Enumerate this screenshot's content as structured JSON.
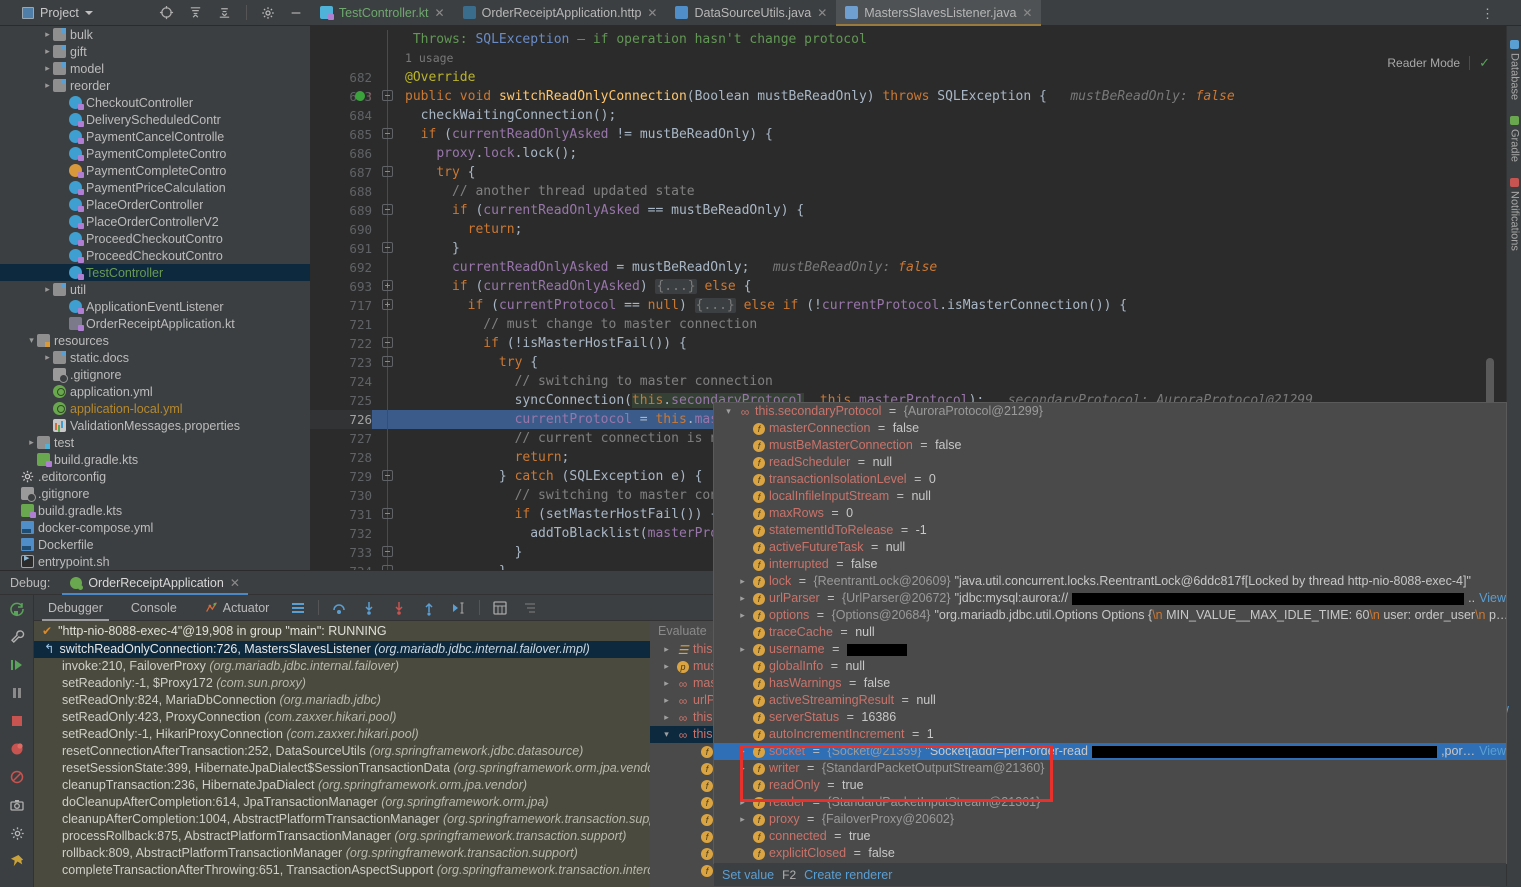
{
  "topbar": {
    "project_label": "Project",
    "icons": [
      "locate-icon",
      "expand-all-icon",
      "collapse-all-icon",
      "settings-gear-icon",
      "hide-icon"
    ],
    "overflow_menu": "⋮"
  },
  "editor_tabs": [
    {
      "label": "TestController.kt",
      "icon": "kotlin-class-icon",
      "active": false,
      "kind": "kt"
    },
    {
      "label": "OrderReceiptApplication.http",
      "icon": "http-request-icon",
      "active": false,
      "kind": "http"
    },
    {
      "label": "DataSourceUtils.java",
      "icon": "java-class-icon",
      "active": false,
      "kind": "java"
    },
    {
      "label": "MastersSlavesListener.java",
      "icon": "java-class-icon",
      "active": true,
      "kind": "javag"
    }
  ],
  "project_tree": [
    {
      "indent": 2,
      "arrow": "▸",
      "icon": "folder-icon",
      "label": "bulk",
      "color": ""
    },
    {
      "indent": 2,
      "arrow": "▸",
      "icon": "folder-icon",
      "label": "gift",
      "color": ""
    },
    {
      "indent": 2,
      "arrow": "▸",
      "icon": "folder-icon",
      "label": "model",
      "color": ""
    },
    {
      "indent": 2,
      "arrow": "▸",
      "icon": "folder-icon",
      "label": "reorder",
      "color": ""
    },
    {
      "indent": 3,
      "arrow": "",
      "icon": "kotlin-class-icon",
      "label": "CheckoutController",
      "color": ""
    },
    {
      "indent": 3,
      "arrow": "",
      "icon": "kotlin-class-icon",
      "label": "DeliveryScheduledContr",
      "color": ""
    },
    {
      "indent": 3,
      "arrow": "",
      "icon": "kotlin-class-icon",
      "label": "PaymentCancelControlle",
      "color": ""
    },
    {
      "indent": 3,
      "arrow": "",
      "icon": "kotlin-class-icon",
      "label": "PaymentCompleteContro",
      "color": ""
    },
    {
      "indent": 3,
      "arrow": "",
      "icon": "kotlin-class-icon-orange",
      "label": "PaymentCompleteContro",
      "color": ""
    },
    {
      "indent": 3,
      "arrow": "",
      "icon": "kotlin-class-icon",
      "label": "PaymentPriceCalculation",
      "color": ""
    },
    {
      "indent": 3,
      "arrow": "",
      "icon": "kotlin-class-icon",
      "label": "PlaceOrderController",
      "color": ""
    },
    {
      "indent": 3,
      "arrow": "",
      "icon": "kotlin-class-icon",
      "label": "PlaceOrderControllerV2",
      "color": ""
    },
    {
      "indent": 3,
      "arrow": "",
      "icon": "kotlin-class-icon",
      "label": "ProceedCheckoutContro",
      "color": ""
    },
    {
      "indent": 3,
      "arrow": "",
      "icon": "kotlin-class-icon",
      "label": "ProceedCheckoutContro",
      "color": ""
    },
    {
      "indent": 3,
      "arrow": "",
      "icon": "kotlin-class-icon",
      "label": "TestController",
      "color": "green",
      "selected": true
    },
    {
      "indent": 2,
      "arrow": "▸",
      "icon": "folder-icon",
      "label": "util",
      "color": ""
    },
    {
      "indent": 3,
      "arrow": "",
      "icon": "kotlin-class-icon",
      "label": "ApplicationEventListener",
      "color": ""
    },
    {
      "indent": 3,
      "arrow": "",
      "icon": "kotlin-file-icon",
      "label": "OrderReceiptApplication.kt",
      "color": ""
    },
    {
      "indent": 1,
      "arrow": "▾",
      "icon": "resources-folder-icon",
      "label": "resources",
      "color": ""
    },
    {
      "indent": 2,
      "arrow": "▸",
      "icon": "folder-plain-icon",
      "label": "static.docs",
      "color": ""
    },
    {
      "indent": 2,
      "arrow": "",
      "icon": "gitignore-icon",
      "label": ".gitignore",
      "color": ""
    },
    {
      "indent": 2,
      "arrow": "",
      "icon": "yaml-icon",
      "label": "application.yml",
      "color": ""
    },
    {
      "indent": 2,
      "arrow": "",
      "icon": "yaml-icon",
      "label": "application-local.yml",
      "color": "yellow"
    },
    {
      "indent": 2,
      "arrow": "",
      "icon": "properties-icon",
      "label": "ValidationMessages.properties",
      "color": ""
    },
    {
      "indent": 1,
      "arrow": "▸",
      "icon": "test-folder-icon",
      "label": "test",
      "color": ""
    },
    {
      "indent": 1,
      "arrow": "",
      "icon": "gradle-icon",
      "label": "build.gradle.kts",
      "color": ""
    },
    {
      "indent": 0,
      "arrow": "",
      "icon": "editorconfig-icon",
      "label": ".editorconfig",
      "color": ""
    },
    {
      "indent": 0,
      "arrow": "",
      "icon": "gitignore-icon",
      "label": ".gitignore",
      "color": ""
    },
    {
      "indent": 0,
      "arrow": "",
      "icon": "gradle-icon",
      "label": "build.gradle.kts",
      "color": ""
    },
    {
      "indent": 0,
      "arrow": "",
      "icon": "docker-compose-icon",
      "label": "docker-compose.yml",
      "color": ""
    },
    {
      "indent": 0,
      "arrow": "",
      "icon": "docker-icon",
      "label": "Dockerfile",
      "color": ""
    },
    {
      "indent": 0,
      "arrow": "",
      "icon": "shell-script-icon",
      "label": "entrypoint.sh",
      "color": ""
    }
  ],
  "editor": {
    "reader_mode_label": "Reader Mode",
    "reader_mode_check": "✓",
    "usage_hint": "1 usage",
    "javadoc_line": {
      "tag": "Throws:",
      "type": "SQLException",
      "text": " – if operation hasn't change protocol"
    },
    "lines": [
      {
        "n": "",
        "code": "javadoc"
      },
      {
        "n": "",
        "code": "usage"
      },
      {
        "n": "682",
        "code": "annotation"
      },
      {
        "n": "683",
        "code": "signature",
        "breakpoint": true
      },
      {
        "n": "684",
        "code": "checkWaiting"
      },
      {
        "n": "685",
        "code": "ifAsked"
      },
      {
        "n": "686",
        "code": "proxyLock"
      },
      {
        "n": "687",
        "code": "try1"
      },
      {
        "n": "688",
        "code": "comment1"
      },
      {
        "n": "689",
        "code": "ifEq"
      },
      {
        "n": "690",
        "code": "return1"
      },
      {
        "n": "691",
        "code": "brace1"
      },
      {
        "n": "692",
        "code": "assign"
      },
      {
        "n": "693",
        "code": "ifElse"
      },
      {
        "n": "717",
        "code": "ifProto"
      },
      {
        "n": "721",
        "code": "comment2"
      },
      {
        "n": "722",
        "code": "ifMasterHostFail"
      },
      {
        "n": "723",
        "code": "try2"
      },
      {
        "n": "724",
        "code": "comment3"
      },
      {
        "n": "725",
        "code": "syncConnection"
      },
      {
        "n": "726",
        "code": "currentProtocol",
        "current": true
      },
      {
        "n": "727",
        "code": "comment4"
      },
      {
        "n": "728",
        "code": "return2"
      },
      {
        "n": "729",
        "code": "catch"
      },
      {
        "n": "730",
        "code": "comment5"
      },
      {
        "n": "731",
        "code": "ifSetMasterHostFail"
      },
      {
        "n": "732",
        "code": "addToBlacklist"
      },
      {
        "n": "733",
        "code": "brace2"
      },
      {
        "n": "734",
        "code": "brace3"
      }
    ],
    "code_text": {
      "usage": "1 usage",
      "annotation": "@Override",
      "signature": "public void switchReadOnlyConnection(Boolean mustBeReadOnly) throws SQLException {",
      "signature_hint": "mustBeReadOnly: false",
      "checkWaiting": "checkWaitingConnection();",
      "ifAsked": "if (currentReadOnlyAsked != mustBeReadOnly) {",
      "proxyLock": "proxy.lock.lock();",
      "try1": "try {",
      "comment1": "// another thread updated state",
      "ifEq": "if (currentReadOnlyAsked == mustBeReadOnly) {",
      "return1": "return;",
      "brace1": "}",
      "assign": "currentReadOnlyAsked = mustBeReadOnly;",
      "assign_hint": "mustBeReadOnly: false",
      "ifElse": "if (currentReadOnlyAsked) {...} else {",
      "ifProto": "if (currentProtocol == null) {...} else if (!currentProtocol.isMasterConnection()) {",
      "comment2": "// must change to master connection",
      "ifMasterHostFail": "if (!isMasterHostFail()) {",
      "try2": "try {",
      "comment3": "// switching to master connection",
      "syncConnection": "syncConnection(this.secondaryProtocol, this.masterProtocol);",
      "syncConnection_hint": "secondaryProtocol: AuroraProtocol@21299",
      "currentProtocol": "currentProtocol = this.masterProtocol;",
      "comment4": "// current connection is now master",
      "return2": "return;",
      "catch": "} catch (SQLException e) {",
      "comment5": "// switching to master connection",
      "ifSetMasterHostFail": "if (setMasterHostFail()) {",
      "addToBlacklist": "addToBlacklist(masterProtocol.getHostAddress());",
      "brace2": "}",
      "brace3": "}"
    }
  },
  "debug": {
    "title": "Debug:",
    "run_config": "OrderReceiptApplication",
    "tabs": [
      "Debugger",
      "Console",
      "Actuator"
    ],
    "active_tab": "Debugger",
    "toolbar_icons": [
      "layout-icon",
      "step-over-icon",
      "step-into-icon",
      "force-step-into-icon",
      "step-out-icon",
      "run-to-cursor-icon",
      "evaluate-icon",
      "mute-breakpoints-icon"
    ],
    "rail_icons": [
      "rerun-icon",
      "settings-wrench-icon",
      "resume-icon",
      "pause-icon",
      "stop-icon",
      "breakpoints-icon",
      "mute-breakpoints-icon",
      "camera-icon",
      "settings-icon",
      "pin-icon"
    ],
    "thread": "\"http-nio-8088-exec-4\"@19,908 in group \"main\": RUNNING",
    "frames": [
      {
        "method": "switchReadOnlyConnection:726, MastersSlavesListener",
        "pkg": "(org.mariadb.jdbc.internal.failover.impl)",
        "selected": true
      },
      {
        "method": "invoke:210, FailoverProxy",
        "pkg": "(org.mariadb.jdbc.internal.failover)"
      },
      {
        "method": "setReadonly:-1, $Proxy172",
        "pkg": "(com.sun.proxy)"
      },
      {
        "method": "setReadOnly:824, MariaDbConnection",
        "pkg": "(org.mariadb.jdbc)"
      },
      {
        "method": "setReadOnly:423, ProxyConnection",
        "pkg": "(com.zaxxer.hikari.pool)"
      },
      {
        "method": "setReadOnly:-1, HikariProxyConnection",
        "pkg": "(com.zaxxer.hikari.pool)"
      },
      {
        "method": "resetConnectionAfterTransaction:252, DataSourceUtils",
        "pkg": "(org.springframework.jdbc.datasource)"
      },
      {
        "method": "resetSessionState:399, HibernateJpaDialect$SessionTransactionData",
        "pkg": "(org.springframework.orm.jpa.vendor)"
      },
      {
        "method": "cleanupTransaction:236, HibernateJpaDialect",
        "pkg": "(org.springframework.orm.jpa.vendor)"
      },
      {
        "method": "doCleanupAfterCompletion:614, JpaTransactionManager",
        "pkg": "(org.springframework.orm.jpa)"
      },
      {
        "method": "cleanupAfterCompletion:1004, AbstractPlatformTransactionManager",
        "pkg": "(org.springframework.transaction.support)"
      },
      {
        "method": "processRollback:875, AbstractPlatformTransactionManager",
        "pkg": "(org.springframework.transaction.support)"
      },
      {
        "method": "rollback:809, AbstractPlatformTransactionManager",
        "pkg": "(org.springframework.transaction.support)"
      },
      {
        "method": "completeTransactionAfterThrowing:651, TransactionAspectSupport",
        "pkg": "(org.springframework.transaction.interceptor)"
      }
    ],
    "evaluate_placeholder": "Evaluate",
    "background_vars": [
      {
        "arrow": "▸",
        "icon": "list-icon",
        "name": "this",
        "rest": "="
      },
      {
        "arrow": "▸",
        "icon": "param-icon",
        "name": "mus",
        "rest": ""
      },
      {
        "arrow": "▸",
        "icon": "infinity-icon",
        "name": "mast",
        "rest": ""
      },
      {
        "arrow": "▸",
        "icon": "infinity-icon",
        "name": "urlPa",
        "rest": ""
      },
      {
        "arrow": "▸",
        "icon": "infinity-icon",
        "name": "this.",
        "rest": ""
      },
      {
        "arrow": "▾",
        "icon": "infinity-icon",
        "name": "this.",
        "rest": "",
        "selected": true
      },
      {
        "arrow": "",
        "icon": "field-icon",
        "name": "m",
        "rest": ""
      },
      {
        "arrow": "",
        "icon": "field-icon",
        "name": "m",
        "rest": ""
      },
      {
        "arrow": "",
        "icon": "field-icon",
        "name": "re",
        "rest": ""
      },
      {
        "arrow": "",
        "icon": "field-icon",
        "name": "tr",
        "rest": ""
      },
      {
        "arrow": "",
        "icon": "field-icon",
        "name": "lo",
        "rest": ""
      },
      {
        "arrow": "",
        "icon": "field-icon",
        "name": "m",
        "rest": ""
      },
      {
        "arrow": "",
        "icon": "field-icon",
        "name": "st",
        "rest": ""
      },
      {
        "arrow": "",
        "icon": "field-icon",
        "name": "ac",
        "rest": ""
      }
    ]
  },
  "variables_popup": {
    "root": {
      "arrow": "▾",
      "icon": "infinity-icon",
      "name": "this.secondaryProtocol",
      "type": "{AuroraProtocol@21299}"
    },
    "rows": [
      {
        "arrow": "",
        "icon": "field-icon",
        "name": "masterConnection",
        "val": "false"
      },
      {
        "arrow": "",
        "icon": "field-icon",
        "name": "mustBeMasterConnection",
        "val": "false"
      },
      {
        "arrow": "",
        "icon": "field-icon",
        "name": "readScheduler",
        "val": "null"
      },
      {
        "arrow": "",
        "icon": "field-icon",
        "name": "transactionIsolationLevel",
        "val": "0"
      },
      {
        "arrow": "",
        "icon": "field-icon",
        "name": "localInfileInputStream",
        "val": "null"
      },
      {
        "arrow": "",
        "icon": "field-icon",
        "name": "maxRows",
        "val": "0"
      },
      {
        "arrow": "",
        "icon": "field-icon",
        "name": "statementIdToRelease",
        "val": "-1"
      },
      {
        "arrow": "",
        "icon": "field-icon",
        "name": "activeFutureTask",
        "val": "null"
      },
      {
        "arrow": "",
        "icon": "field-icon",
        "name": "interrupted",
        "val": "false"
      },
      {
        "arrow": "▸",
        "icon": "field-icon",
        "name": "lock",
        "type": "{ReentrantLock@20609}",
        "val": "\"java.util.concurrent.locks.ReentrantLock@6ddc817f[Locked by thread http-nio-8088-exec-4]\""
      },
      {
        "arrow": "▸",
        "icon": "field-icon",
        "name": "urlParser",
        "type": "{UrlParser@20672}",
        "val": "\"jdbc:mysql:aurora://",
        "redacted": 400,
        "tail": ".. ",
        "link": "View"
      },
      {
        "arrow": "▸",
        "icon": "field-icon",
        "name": "options",
        "type": "{Options@20684}",
        "val_html": "options",
        "link": "View"
      },
      {
        "arrow": "",
        "icon": "field-icon",
        "name": "traceCache",
        "val": "null"
      },
      {
        "arrow": "▸",
        "icon": "field-icon",
        "name": "username",
        "val": "",
        "redacted": 60
      },
      {
        "arrow": "",
        "icon": "field-icon",
        "name": "globalInfo",
        "val": "null"
      },
      {
        "arrow": "",
        "icon": "field-icon",
        "name": "hasWarnings",
        "val": "false"
      },
      {
        "arrow": "",
        "icon": "field-icon",
        "name": "activeStreamingResult",
        "val": "null"
      },
      {
        "arrow": "",
        "icon": "field-icon",
        "name": "serverStatus",
        "val": "16386"
      },
      {
        "arrow": "",
        "icon": "field-icon",
        "name": "autoIncrementIncrement",
        "val": "1"
      },
      {
        "arrow": "▸",
        "icon": "field-icon",
        "name": "socket",
        "type": "{Socket@21359}",
        "val": "\"Socket[addr=perf-order-read",
        "redacted": 350,
        "tail": ",por… ",
        "link": "View",
        "selected": true
      },
      {
        "arrow": "▸",
        "icon": "field-icon",
        "name": "writer",
        "type": "{StandardPacketOutputStream@21360}",
        "val": ""
      },
      {
        "arrow": "",
        "icon": "field-icon",
        "name": "readOnly",
        "val": "true"
      },
      {
        "arrow": "▸",
        "icon": "field-icon",
        "name": "reader",
        "type": "{StandardPacketInputStream@21361}",
        "val": ""
      },
      {
        "arrow": "▸",
        "icon": "field-icon",
        "name": "proxy",
        "type": "{FailoverProxy@20602}",
        "val": ""
      },
      {
        "arrow": "",
        "icon": "field-icon",
        "name": "connected",
        "val": "true"
      },
      {
        "arrow": "",
        "icon": "field-icon",
        "name": "explicitClosed",
        "val": "false"
      }
    ],
    "options_value_parts": [
      {
        "t": "\"org.mariadb.jdbc.util.Options Options {",
        "k": "str"
      },
      {
        "t": "\\n",
        "k": "esc"
      },
      {
        "t": "  MIN_VALUE__MAX_IDLE_TIME: 60",
        "k": "str"
      },
      {
        "t": "\\n",
        "k": "esc"
      },
      {
        "t": "  user: order_user",
        "k": "str"
      },
      {
        "t": "\\n",
        "k": "esc"
      },
      {
        "t": "  p… ",
        "k": "str"
      }
    ],
    "footer": {
      "set_value": "Set value",
      "shortcut": "F2",
      "create_renderer": "Create renderer"
    },
    "annotation_highlight_color": "#e8312a"
  },
  "right_rail": [
    {
      "label": "Database",
      "icon": "database-icon"
    },
    {
      "label": "Gradle",
      "icon": "gradle-elephant-icon"
    },
    {
      "label": "Notifications",
      "icon": "bell-icon"
    }
  ],
  "side_view_links": {
    "view": "View"
  }
}
